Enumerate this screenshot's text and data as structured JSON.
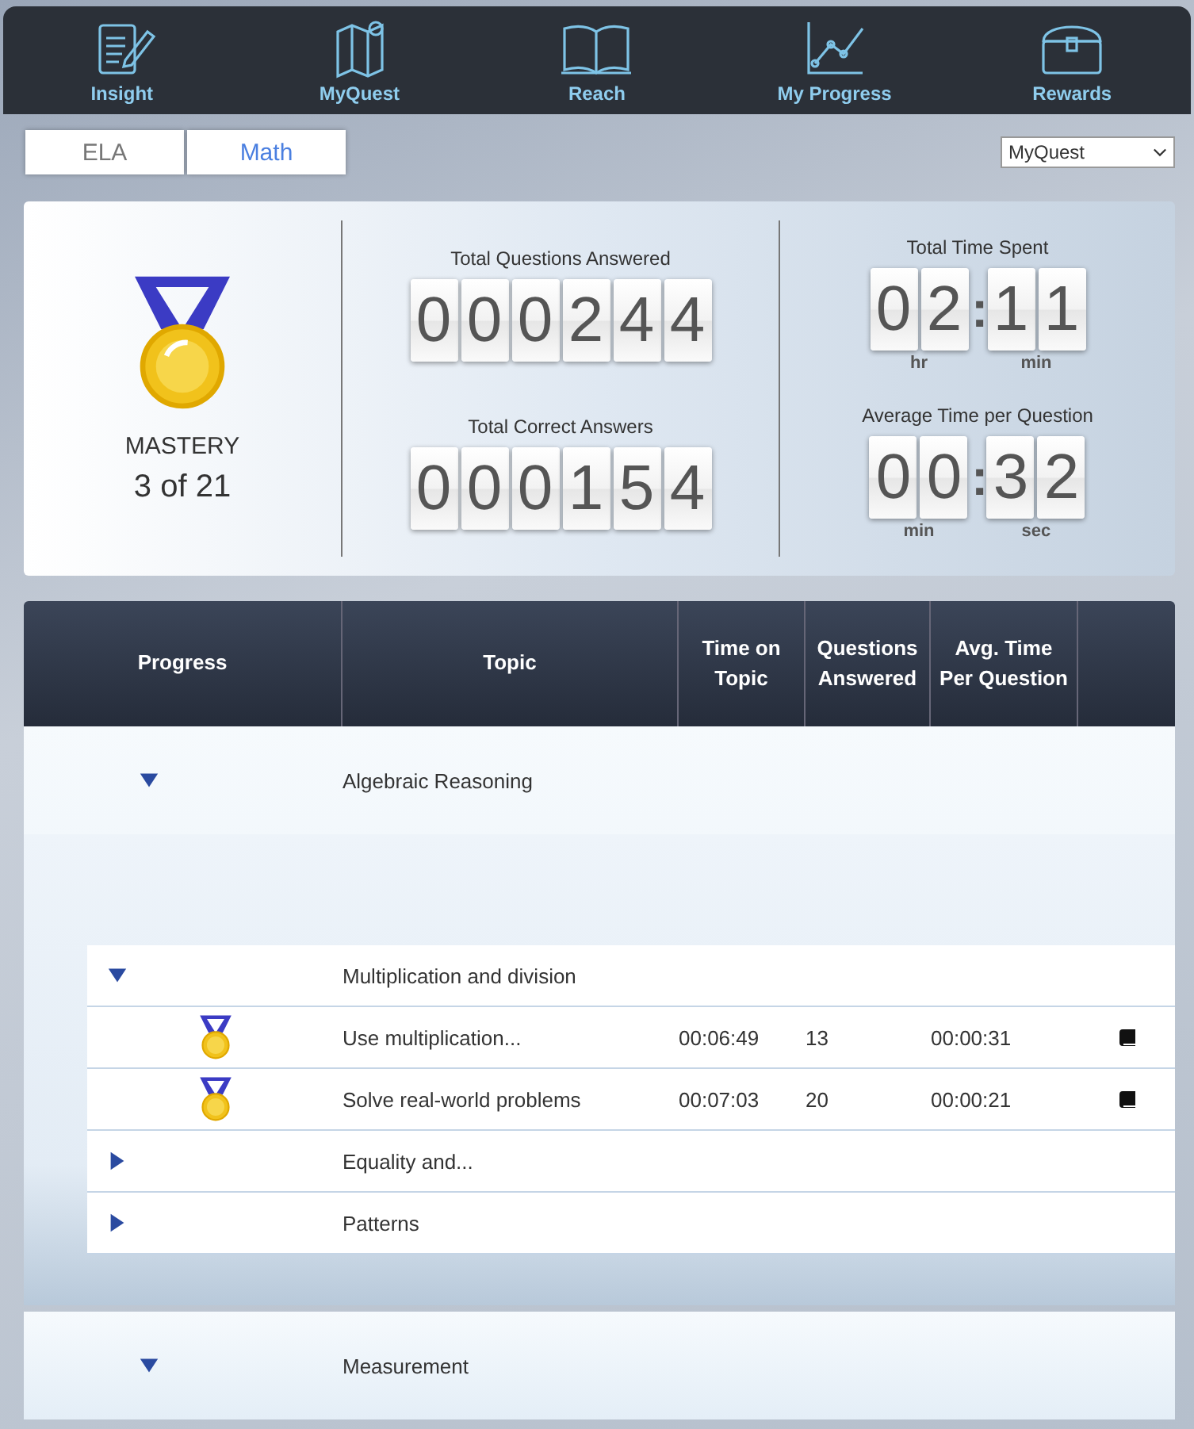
{
  "nav": [
    {
      "label": "Insight",
      "kind": "document"
    },
    {
      "label": "MyQuest",
      "kind": "map"
    },
    {
      "label": "Reach",
      "kind": "book"
    },
    {
      "label": "My Progress",
      "kind": "chart"
    },
    {
      "label": "Rewards",
      "kind": "chest"
    }
  ],
  "subject_tabs": [
    {
      "label": "ELA",
      "selected": false
    },
    {
      "label": "Math",
      "selected": true
    }
  ],
  "dropdown": {
    "value": "MyQuest"
  },
  "mastery": {
    "label": "MASTERY",
    "value": "3 of 21"
  },
  "counters": [
    {
      "title": "Total Questions Answered",
      "digits": [
        "0",
        "0",
        "0",
        "2",
        "4",
        "4"
      ]
    },
    {
      "title": "Total Correct Answers",
      "digits": [
        "0",
        "0",
        "0",
        "1",
        "5",
        "4"
      ]
    }
  ],
  "timers": [
    {
      "title": "Total Time Spent",
      "separator": ":",
      "groups": [
        {
          "digits": [
            "0",
            "2"
          ],
          "unit": "hr"
        },
        {
          "digits": [
            "1",
            "1"
          ],
          "unit": "min"
        }
      ]
    },
    {
      "title": "Average Time per Question",
      "separator": ":",
      "groups": [
        {
          "digits": [
            "0",
            "0"
          ],
          "unit": "min"
        },
        {
          "digits": [
            "3",
            "2"
          ],
          "unit": "sec"
        }
      ]
    }
  ],
  "table": {
    "columns": [
      "Progress",
      "Topic",
      "Time on Topic",
      "Questions Answered",
      "Avg. Time Per Question"
    ],
    "topics": [
      {
        "name": "Algebraic Reasoning",
        "expanded": true,
        "children": [
          {
            "name": "Multiplication and division",
            "expanded": true,
            "children": [
              {
                "name": "Use multiplication...",
                "mastered": true,
                "time": "00:06:49",
                "questions": "13",
                "avg": "00:00:31"
              },
              {
                "name": "Solve real-world problems",
                "mastered": true,
                "time": "00:07:03",
                "questions": "20",
                "avg": "00:00:21"
              }
            ]
          },
          {
            "name": "Equality and...",
            "expanded": false
          },
          {
            "name": "Patterns",
            "expanded": false
          }
        ]
      },
      {
        "name": "Measurement",
        "expanded": true
      }
    ]
  }
}
